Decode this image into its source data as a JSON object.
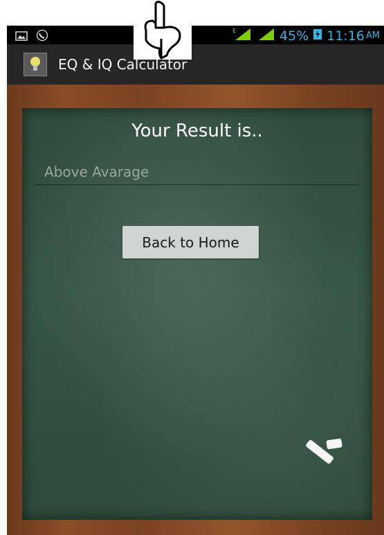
{
  "statusbar": {
    "left_icons": [
      "picture-icon",
      "call-icon"
    ],
    "network_label": "E",
    "battery": "45%",
    "time": "11:16",
    "ampm": "AM"
  },
  "actionbar": {
    "app_icon": "lightbulb-icon",
    "title": "EQ & IQ Calculator"
  },
  "main": {
    "heading": "Your Result is..",
    "result": "Above Avarage",
    "home_button": "Back to Home"
  },
  "colors": {
    "statusbar_accent": "#33b5e5",
    "board": "#2f4c3d",
    "frame": "#7a4322"
  }
}
